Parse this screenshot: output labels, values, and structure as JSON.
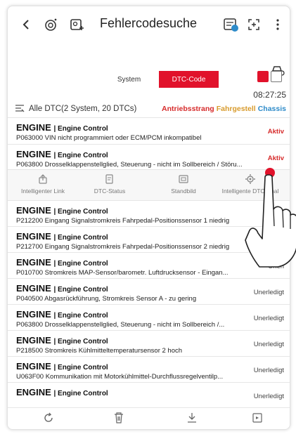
{
  "header": {
    "title": "Fehlercodesuche"
  },
  "tabs": [
    {
      "label": "System",
      "active": false
    },
    {
      "label": "DTC-Code",
      "active": true
    }
  ],
  "summary": {
    "time": "08:27:25",
    "text": "Alle DTC(2 System, 20 DTCs)",
    "systems": [
      {
        "label": "Antriebsstrang",
        "color": "#d62b2b"
      },
      {
        "label": "Fahrgestell",
        "color": "#d89b2d"
      },
      {
        "label": "Chassis",
        "color": "#2e8bc9"
      }
    ]
  },
  "dtc_items": [
    {
      "system": "ENGINE",
      "desc": "Engine Control",
      "code": "P063000 VIN nicht programmiert oder ECM/PCM inkompatibel",
      "status": "Aktiv"
    },
    {
      "system": "ENGINE",
      "desc": "Engine Control",
      "code": "P063800 Drosselklappenstellglied, Steuerung - nicht im Sollbereich / Störu...",
      "status": "Aktiv"
    },
    {
      "system": "ENGINE",
      "desc": "Engine Control",
      "code": "P212200 Eingang Signalstromkreis Fahrpedal-Positionssensor 1 niedrig",
      "status": ""
    },
    {
      "system": "ENGINE",
      "desc": "Engine Control",
      "code": "P212700 Eingang Signalstromkreis Fahrpedal-Positionssensor 2 niedrig",
      "status": ""
    },
    {
      "system": "ENGINE",
      "desc": "Engine Control",
      "code": "P010700 Stromkreis MAP-Sensor/barometr. Luftdrucksensor - Eingan...",
      "status": "Unerl"
    },
    {
      "system": "ENGINE",
      "desc": "Engine Control",
      "code": "P040500 Abgasrückführung, Stromkreis Sensor A - zu gering",
      "status": "Unerledigt"
    },
    {
      "system": "ENGINE",
      "desc": "Engine Control",
      "code": "P063800 Drosselklappenstellglied, Steuerung - nicht im Sollbereich /...",
      "status": "Unerledigt"
    },
    {
      "system": "ENGINE",
      "desc": "Engine Control",
      "code": "P218500 Stromkreis Kühlmitteltemperatursensor 2 hoch",
      "status": "Unerledigt"
    },
    {
      "system": "ENGINE",
      "desc": "Engine Control",
      "code": "U063F00 Kommunikation mit Motorkühlmittel-Durchflussregelventilp...",
      "status": "Unerledigt"
    },
    {
      "system": "ENGINE",
      "desc": "Engine Control",
      "code": "",
      "status": "Unerledigt"
    }
  ],
  "actions": [
    {
      "label": "Intelligenter Link",
      "icon": "share-icon"
    },
    {
      "label": "DTC-Status",
      "icon": "document-icon"
    },
    {
      "label": "Standbild",
      "icon": "freeze-frame-icon"
    },
    {
      "label": "Intelligente DTC-Anal",
      "icon": "gear-icon"
    }
  ],
  "colors": {
    "accent": "#e1122b",
    "active_status": "#d62b2b"
  }
}
